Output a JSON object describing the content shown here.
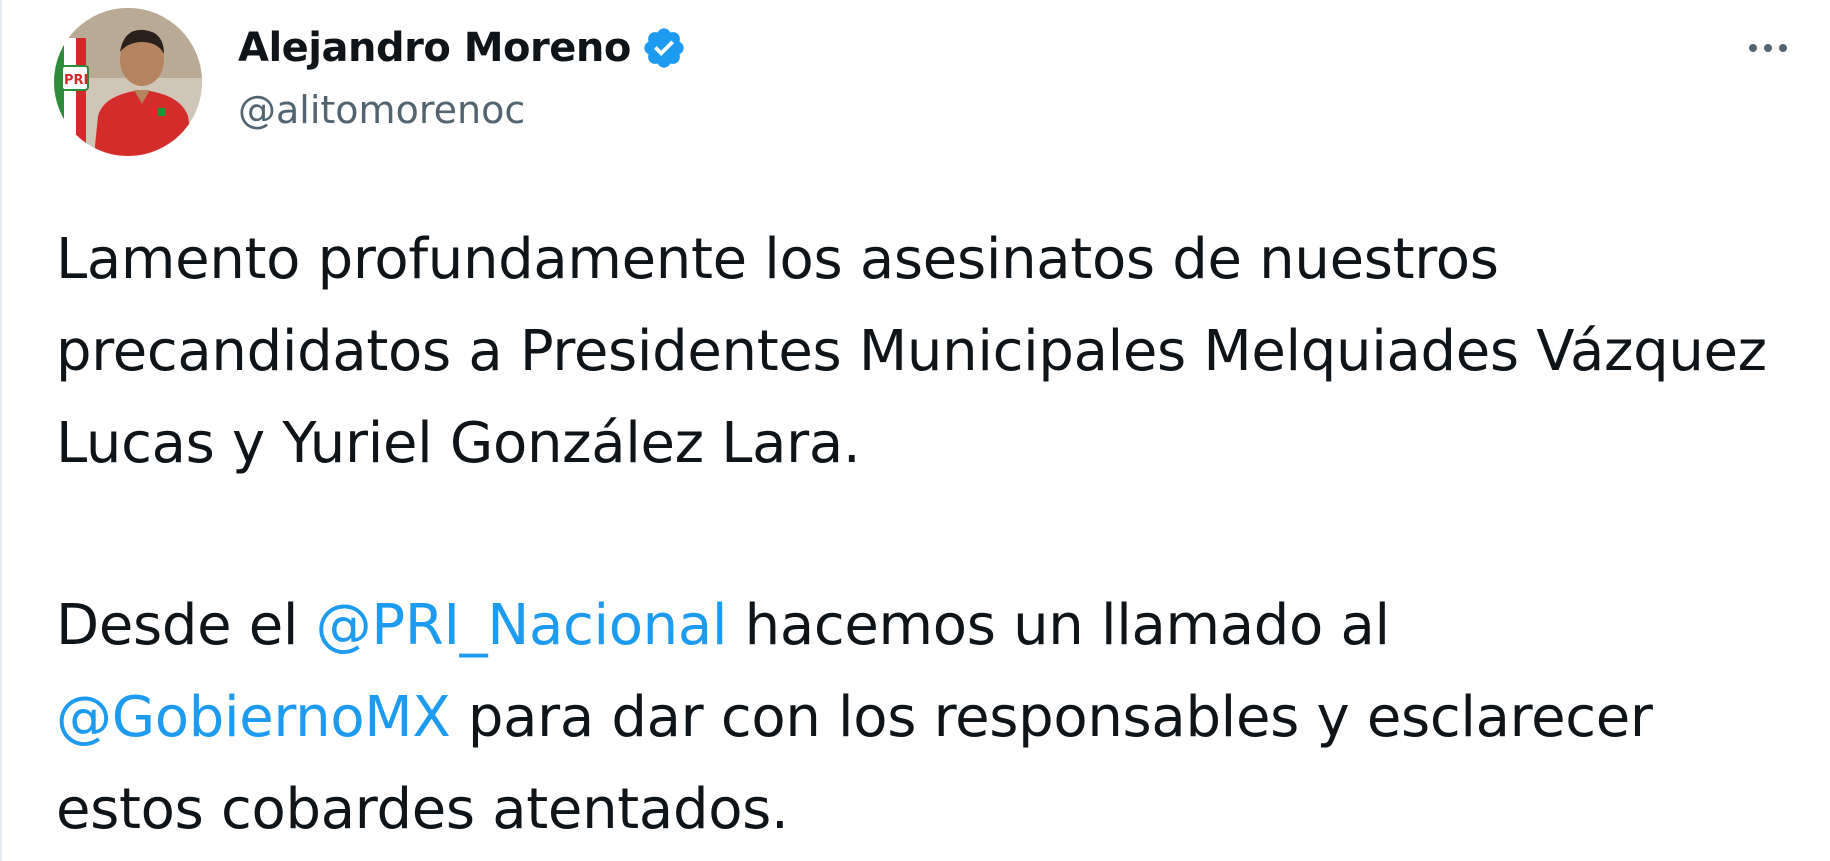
{
  "tweet": {
    "author": {
      "display_name": "Alejandro Moreno",
      "handle": "@alitomorenoc",
      "verified": true,
      "avatar_label": "PRI"
    },
    "more_icon": "more-horizontal-icon",
    "paragraph_1": "Lamento profundamente los asesinatos de nuestros precandidatos a Presidentes Municipales Melquiades Vázquez Lucas y Yuriel González Lara.",
    "paragraph_2": {
      "part_1": "Desde el ",
      "mention_1": "@PRI_Nacional",
      "part_2": " hacemos un llamado al ",
      "mention_2": "@GobiernoMX",
      "part_3": " para dar con los responsables y esclarecer estos cobardes atentados."
    }
  },
  "colors": {
    "text": "#0f1419",
    "secondary": "#536471",
    "mention": "#1d9bf0",
    "verified_badge": "#1d9bf0"
  }
}
